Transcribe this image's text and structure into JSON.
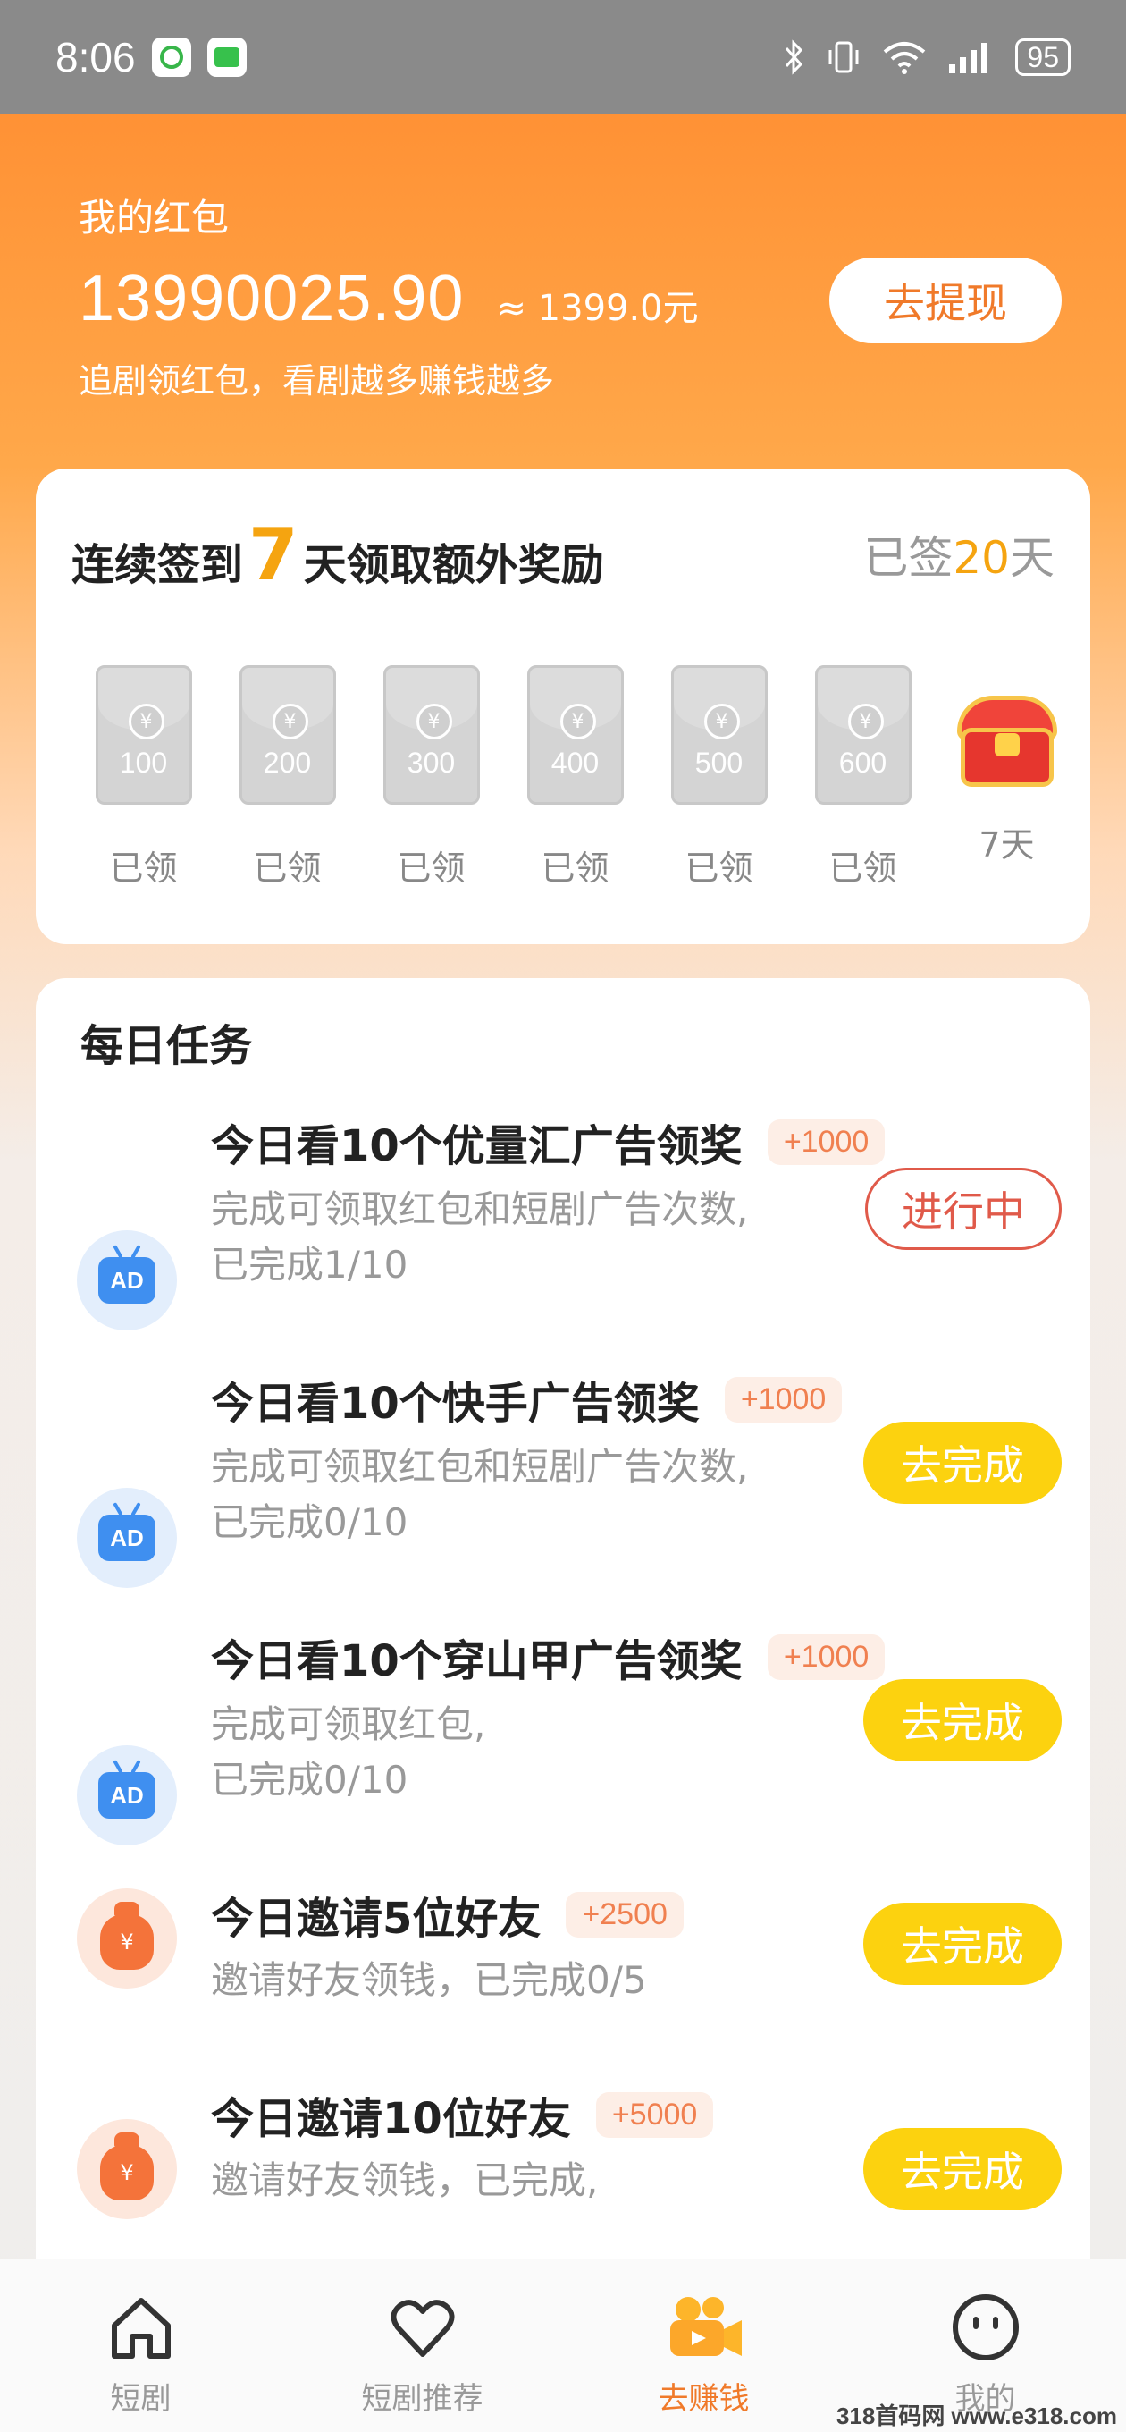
{
  "status_bar": {
    "time": "8:06",
    "battery": "95"
  },
  "wallet": {
    "title": "我的红包",
    "amount": "13990025.90",
    "approx": "≈ 1399.0元",
    "subtitle": "追剧领红包，看剧越多赚钱越多",
    "withdraw_label": "去提现"
  },
  "signin": {
    "heading_prefix": "连续签到",
    "heading_days": "7",
    "heading_suffix": "天领取额外奖励",
    "signed_prefix": "已签",
    "signed_days": "20",
    "signed_suffix": "天",
    "rewards": [
      {
        "value": "100",
        "label": "已领"
      },
      {
        "value": "200",
        "label": "已领"
      },
      {
        "value": "300",
        "label": "已领"
      },
      {
        "value": "400",
        "label": "已领"
      },
      {
        "value": "500",
        "label": "已领"
      },
      {
        "value": "600",
        "label": "已领"
      }
    ],
    "final_label": "7天",
    "coin_symbol": "¥"
  },
  "tasks": {
    "title": "每日任务",
    "items": [
      {
        "title": "今日看10个优量汇广告领奖",
        "reward": "+1000",
        "desc1": "完成可领取红包和短剧广告次数,",
        "desc2": "已完成1/10",
        "button": "进行中",
        "icon": "ad-icon"
      },
      {
        "title": "今日看10个快手广告领奖",
        "reward": "+1000",
        "desc1": "完成可领取红包和短剧广告次数,",
        "desc2": "已完成0/10",
        "button": "去完成",
        "icon": "ad-icon"
      },
      {
        "title": "今日看10个穿山甲广告领奖",
        "reward": "+1000",
        "desc1": "完成可领取红包,",
        "desc2": "已完成0/10",
        "button": "去完成",
        "icon": "ad-icon"
      },
      {
        "title": "今日邀请5位好友",
        "reward": "+2500",
        "desc1": "邀请好友领钱，已完成0/5",
        "desc2": "",
        "button": "去完成",
        "icon": "money-bag-icon"
      },
      {
        "title": "今日邀请10位好友",
        "reward": "+5000",
        "desc1": "邀请好友领钱，已完成,",
        "desc2": "",
        "button": "去完成",
        "icon": "money-bag-icon"
      }
    ],
    "ad_text": "AD",
    "bag_symbol": "¥"
  },
  "nav": {
    "items": [
      {
        "label": "短剧",
        "icon": "home-icon"
      },
      {
        "label": "短剧推荐",
        "icon": "heart-icon"
      },
      {
        "label": "去赚钱",
        "icon": "earn-camera-icon"
      },
      {
        "label": "我的",
        "icon": "face-icon"
      }
    ]
  },
  "watermark": "318首码网 www.e318.com",
  "colors": {
    "accent": "#f07a2a",
    "gold": "#f5a410",
    "go_button": "#fcd20f",
    "progress_red": "#e05a4a"
  }
}
